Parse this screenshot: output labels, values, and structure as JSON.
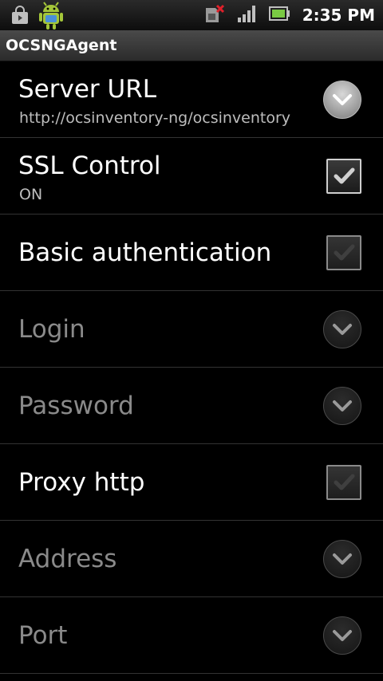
{
  "status_bar": {
    "time": "2:35 PM",
    "icons": [
      "shopping-bag-icon",
      "android-robot-icon",
      "sim-missing-icon",
      "signal-icon",
      "battery-icon"
    ]
  },
  "app": {
    "title": "OCSNGAgent"
  },
  "prefs": [
    {
      "title": "Server URL",
      "summary": "http://ocsinventory-ng/ocsinventory",
      "control": "dropdown",
      "enabled": true
    },
    {
      "title": "SSL Control",
      "summary": "ON",
      "control": "checkbox",
      "checked": true,
      "enabled": true
    },
    {
      "title": "Basic authentication",
      "control": "checkbox",
      "checked": false,
      "enabled": true
    },
    {
      "title": "Login",
      "control": "dropdown",
      "enabled": false
    },
    {
      "title": "Password",
      "control": "dropdown",
      "enabled": false
    },
    {
      "title": "Proxy http",
      "control": "checkbox",
      "checked": false,
      "enabled": true
    },
    {
      "title": "Address",
      "control": "dropdown",
      "enabled": false
    },
    {
      "title": "Port",
      "control": "dropdown",
      "enabled": false
    }
  ],
  "colors": {
    "background": "#000000",
    "disabled_text": "#8a8a8a",
    "summary_text": "#bdbdbd"
  }
}
